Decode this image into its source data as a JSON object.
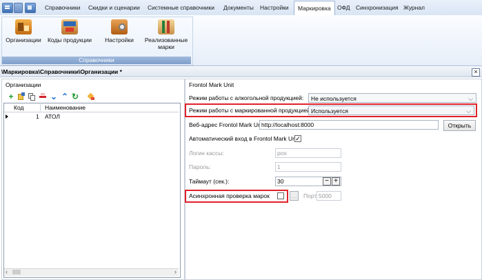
{
  "tabbar": {
    "tabs": [
      {
        "label": "Справочники",
        "active": false
      },
      {
        "label": "Скидки и сценарии",
        "active": false
      },
      {
        "label": "Системные справочники",
        "active": false
      },
      {
        "label": "Документы",
        "active": false
      },
      {
        "label": "Настройки",
        "active": false
      },
      {
        "label": "Маркировка",
        "active": true
      },
      {
        "label": "ОФД",
        "active": false
      },
      {
        "label": "Синхронизация",
        "active": false
      },
      {
        "label": "Журнал",
        "active": false
      }
    ]
  },
  "ribbon": {
    "buttons": [
      {
        "label": "Организации",
        "icon": "organizations-icon"
      },
      {
        "label": "Коды продукции",
        "icon": "product-codes-icon"
      },
      {
        "label": "Настройки",
        "icon": "settings-icon"
      },
      {
        "label_line1": "Реализованные",
        "label_line2": "марки",
        "icon": "sold-marks-icon"
      }
    ],
    "group_label": "Справочники"
  },
  "document": {
    "title": "\\Маркировка\\Справочники\\Организации *"
  },
  "left": {
    "group_title": "Организации",
    "toolbar_icons": [
      "add-icon",
      "edit-icon",
      "copy-icon",
      "delete-icon",
      "move-down-icon",
      "move-up-icon",
      "refresh-icon",
      "clear-icon"
    ],
    "columns": [
      "Код",
      "Наименование"
    ],
    "rows": [
      {
        "code": "1",
        "name": "АТОЛ"
      }
    ]
  },
  "right": {
    "group_title": "Frontol Mark Unit",
    "alcohol_label": "Режим работы с алкогольной продукцией:",
    "alcohol_value": "Не используется",
    "marked_label": "Режим работы с маркированной продукцией:",
    "marked_value": "Используется",
    "url_label": "Веб-адрес Frontol Mark Unit:",
    "url_value": "http://localhost:8000",
    "open_button": "Открыть",
    "auto_login_label": "Автоматический вход в Frontol Mark Unit",
    "auto_login_checked": true,
    "login_label": "Логин кассы:",
    "login_value": "pos",
    "password_label": "Пароль:",
    "password_value": "1",
    "timeout_label": "Таймаут (сек.):",
    "timeout_value": "30",
    "async_label": "Асинхронная проверка марок",
    "async_checked": false,
    "port_label": "Порт",
    "port_value": "5000"
  },
  "colors": {
    "highlight": "#e0202a",
    "ribbon_accent": "#7e9fcb"
  }
}
